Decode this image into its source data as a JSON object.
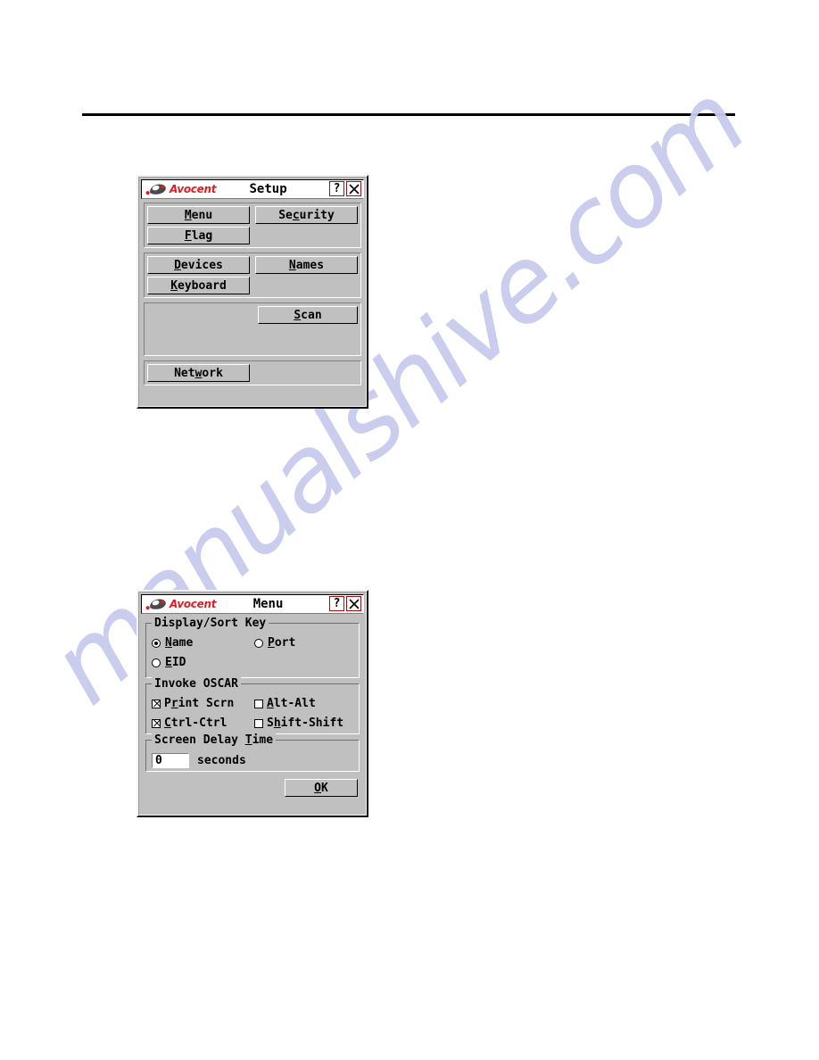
{
  "page": {
    "watermark": "manualshive.com",
    "rule": "horizontal-rule"
  },
  "brand": {
    "name": "Avocent",
    "logo_icon": "avocent-swoosh-logo",
    "color": "#d81f26"
  },
  "setup_dialog": {
    "title": "Setup",
    "help_button": "?",
    "close_button": "✕",
    "groups": [
      {
        "name": "display-group",
        "rows": [
          {
            "buttons": [
              {
                "label_pre": "",
                "label_u": "M",
                "label_post": "enu",
                "name": "menu-button"
              },
              {
                "label_pre": "Se",
                "label_u": "c",
                "label_post": "urity",
                "name": "security-button"
              }
            ]
          },
          {
            "buttons": [
              {
                "label_pre": "",
                "label_u": "F",
                "label_post": "lag",
                "name": "flag-button"
              }
            ]
          }
        ]
      },
      {
        "name": "devices-group",
        "rows": [
          {
            "buttons": [
              {
                "label_pre": "",
                "label_u": "D",
                "label_post": "evices",
                "name": "devices-button"
              },
              {
                "label_pre": "",
                "label_u": "N",
                "label_post": "ames",
                "name": "names-button"
              }
            ]
          },
          {
            "buttons": [
              {
                "label_pre": "",
                "label_u": "K",
                "label_post": "eyboard",
                "name": "keyboard-button"
              }
            ]
          }
        ]
      },
      {
        "name": "scan-group",
        "rows": [
          {
            "buttons": [
              {
                "label_pre": "",
                "label_u": "S",
                "label_post": "can",
                "name": "scan-button",
                "offset": true
              }
            ]
          }
        ]
      },
      {
        "name": "network-group",
        "rows": [
          {
            "buttons": [
              {
                "label_pre": "Net",
                "label_u": "w",
                "label_post": "ork",
                "name": "network-button"
              }
            ]
          }
        ]
      }
    ]
  },
  "menu_dialog": {
    "title": "Menu",
    "help_button": "?",
    "close_button": "✕",
    "display_sort": {
      "legend": "Display/Sort Key",
      "options": [
        {
          "pre": "",
          "u": "N",
          "post": "ame",
          "checked": true,
          "name": "radio-name"
        },
        {
          "pre": "",
          "u": "P",
          "post": "ort",
          "checked": false,
          "name": "radio-port"
        },
        {
          "pre": "",
          "u": "E",
          "post": "ID",
          "checked": false,
          "name": "radio-eid"
        }
      ]
    },
    "invoke_oscar": {
      "legend": "Invoke OSCAR",
      "options": [
        {
          "pre": "P",
          "u": "r",
          "post": "int Scrn",
          "checked": true,
          "name": "checkbox-print-scrn"
        },
        {
          "pre": "",
          "u": "A",
          "post": "lt-Alt",
          "checked": false,
          "name": "checkbox-alt-alt"
        },
        {
          "pre": "",
          "u": "C",
          "post": "trl-Ctrl",
          "checked": true,
          "name": "checkbox-ctrl-ctrl"
        },
        {
          "pre": "S",
          "u": "h",
          "post": "ift-Shift",
          "checked": false,
          "name": "checkbox-shift-shift"
        }
      ]
    },
    "screen_delay": {
      "legend_pre": "Screen Delay ",
      "legend_u": "T",
      "legend_post": "ime",
      "value": "0",
      "units": "seconds"
    },
    "ok_button": {
      "pre": "",
      "u": "O",
      "post": "K"
    }
  }
}
